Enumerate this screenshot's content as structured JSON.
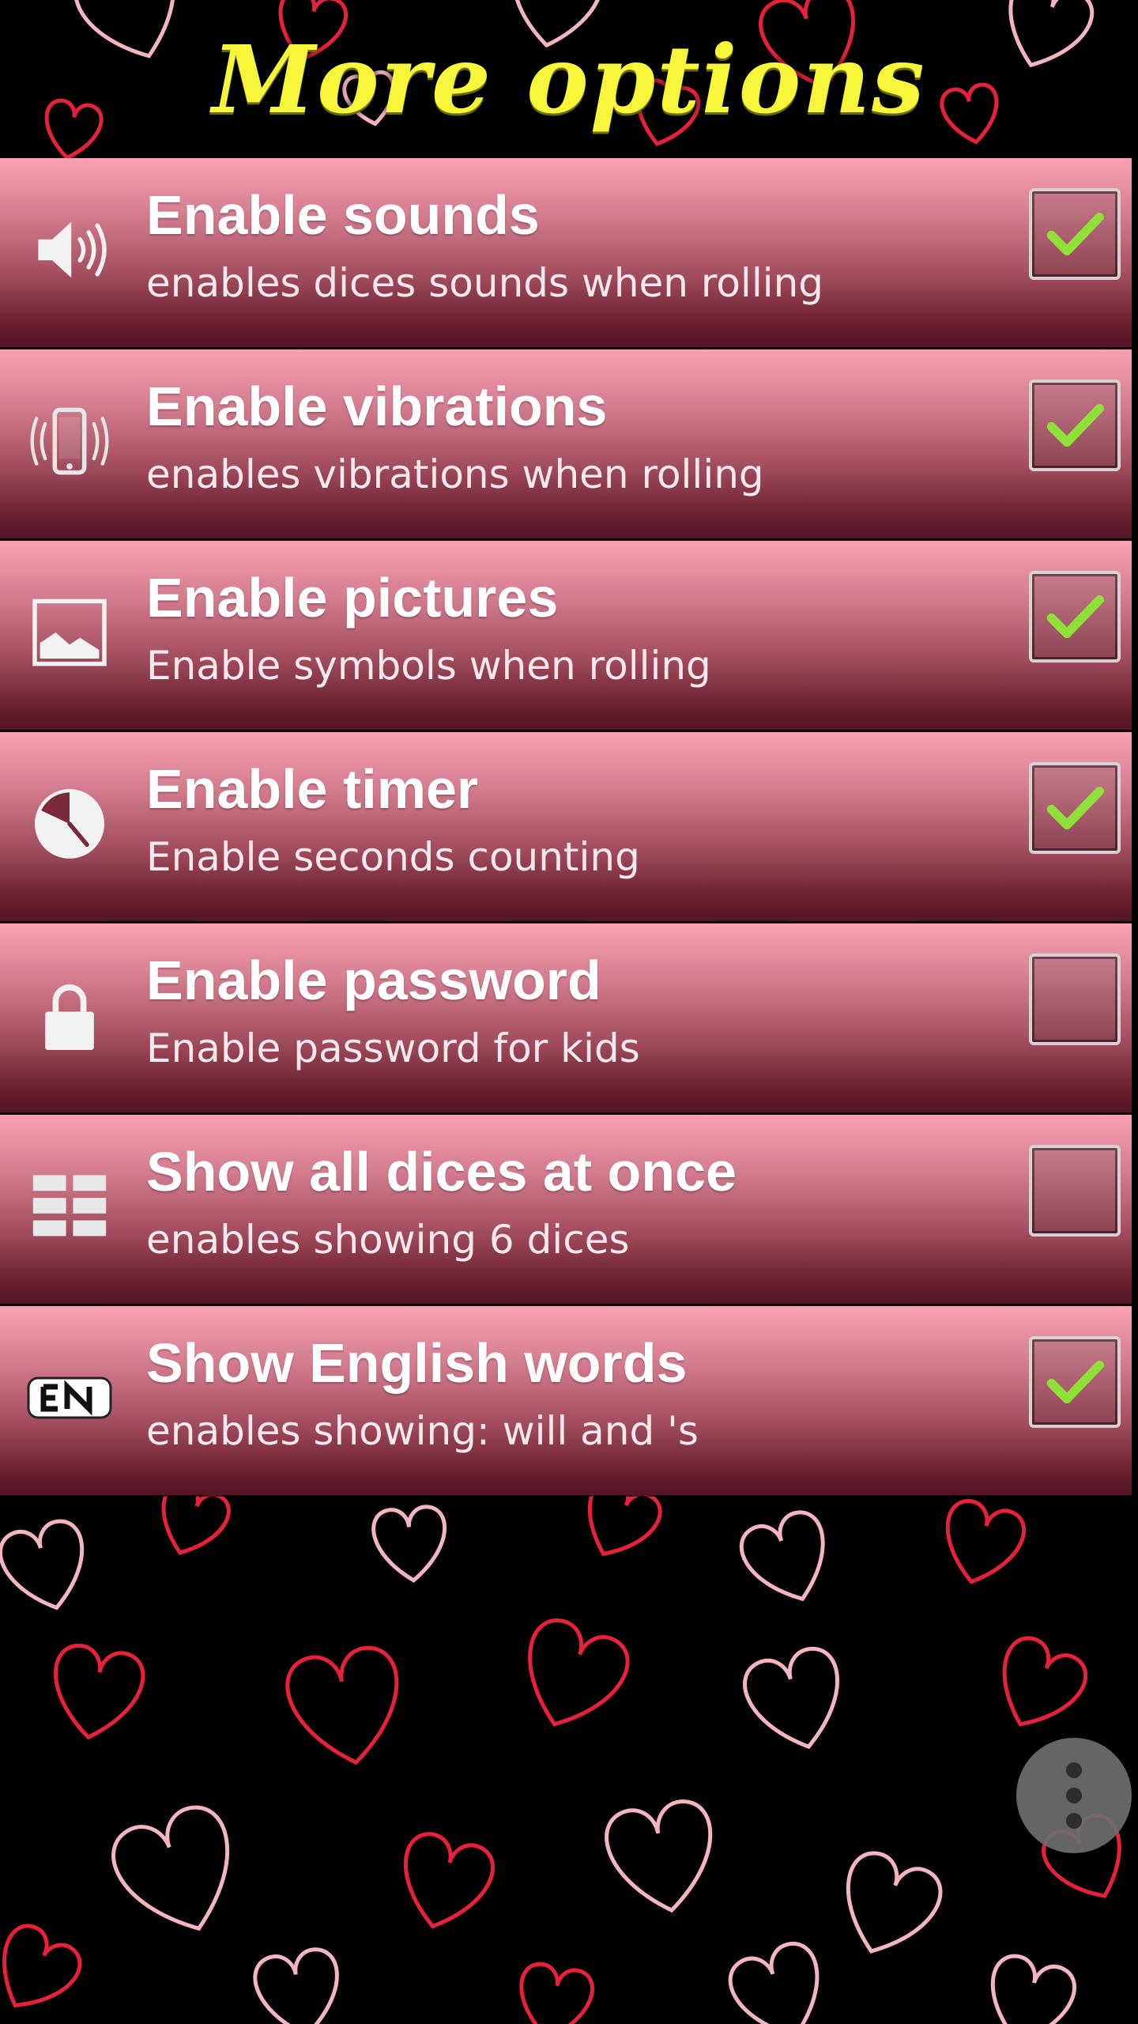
{
  "header": {
    "title": "More options"
  },
  "colors": {
    "title": "#f8f63a",
    "row_top": "#f8a1b2",
    "row_bottom": "#531626",
    "check": "#8fe038",
    "heart_red": "#e8203a",
    "heart_pink": "#f4b4c0"
  },
  "options": [
    {
      "icon": "speaker-icon",
      "label": "Enable sounds",
      "description": "enables dices sounds when rolling",
      "checked": true
    },
    {
      "icon": "vibrate-phone-icon",
      "label": "Enable vibrations",
      "description": "enables vibrations when rolling",
      "checked": true
    },
    {
      "icon": "picture-icon",
      "label": "Enable pictures",
      "description": "Enable symbols when rolling",
      "checked": true
    },
    {
      "icon": "clock-icon",
      "label": "Enable timer",
      "description": "Enable seconds counting",
      "checked": true
    },
    {
      "icon": "lock-icon",
      "label": "Enable password",
      "description": "Enable password for kids",
      "checked": false
    },
    {
      "icon": "grid-icon",
      "label": "Show all dices at once",
      "description": "enables showing 6 dices",
      "checked": false
    },
    {
      "icon": "en-icon",
      "label": "Show English words",
      "description": "enables showing: will and 's",
      "checked": true
    }
  ],
  "overflow_menu": {
    "icon": "more-vert-icon"
  }
}
